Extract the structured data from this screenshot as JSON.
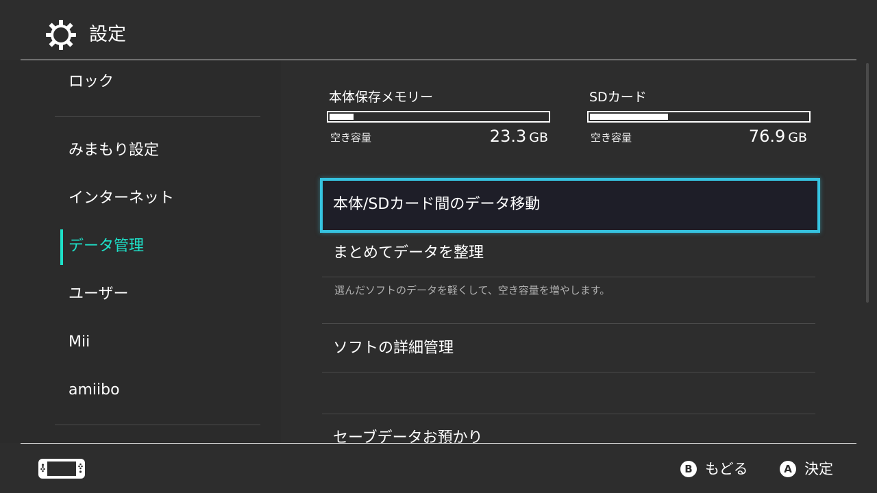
{
  "header": {
    "title": "設定",
    "icon": "gear-icon"
  },
  "sidebar": {
    "items": [
      {
        "label": "ロック"
      },
      {
        "label": "みまもり設定"
      },
      {
        "label": "インターネット"
      },
      {
        "label": "データ管理"
      },
      {
        "label": "ユーザー"
      },
      {
        "label": "Mii"
      },
      {
        "label": "amiibo"
      }
    ],
    "active_index": 3
  },
  "storage": {
    "system": {
      "label": "本体保存メモリー",
      "free_label": "空き容量",
      "free_value": "23.3",
      "unit": "GB",
      "used_fraction": 0.11
    },
    "sd": {
      "label": "SDカード",
      "free_label": "空き容量",
      "free_value": "76.9",
      "unit": "GB",
      "used_fraction": 0.36
    }
  },
  "menu": {
    "items": [
      {
        "label": "本体/SDカード間のデータ移動"
      },
      {
        "label": "まとめてデータを整理"
      },
      {
        "label": "ソフトの詳細管理"
      },
      {
        "label": "セーブデータお預かり"
      }
    ],
    "description": "選んだソフトのデータを軽くして、空き容量を増やします。",
    "selected_index": 0
  },
  "footer": {
    "back": {
      "button": "B",
      "label": "もどる"
    },
    "confirm": {
      "button": "A",
      "label": "決定"
    }
  },
  "colors": {
    "accent": "#1ee0c8",
    "selection": "#36c3e0",
    "background": "#2d2d2d"
  }
}
